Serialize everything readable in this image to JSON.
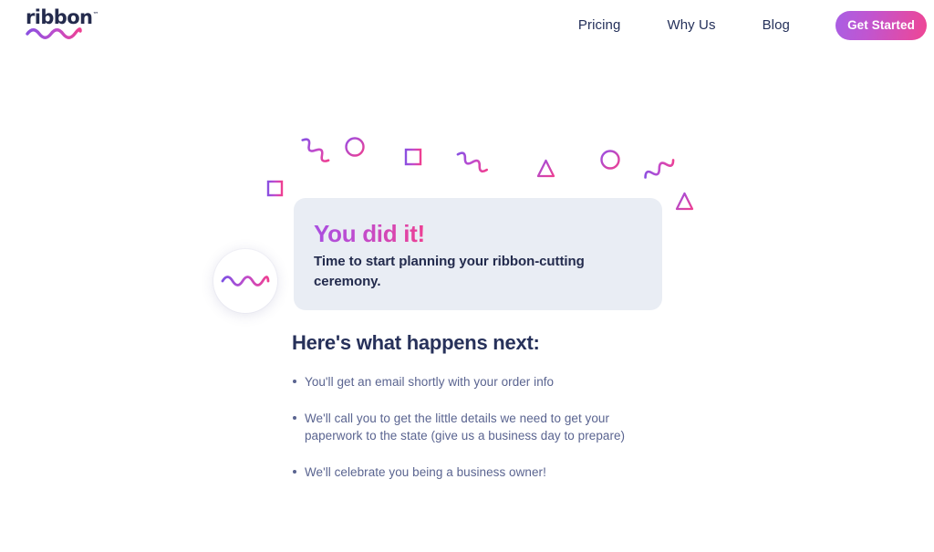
{
  "header": {
    "brand": {
      "name": "ribbon",
      "trademark": "™",
      "wave_icon": "ribbon-wave-icon"
    },
    "nav": [
      {
        "label": "Pricing",
        "name": "nav-link-pricing"
      },
      {
        "label": "Why Us",
        "name": "nav-link-why-us"
      },
      {
        "label": "Blog",
        "name": "nav-link-blog"
      }
    ],
    "cta": {
      "label": "Get Started"
    }
  },
  "hero": {
    "seal": {
      "icon": "wave-squiggle-icon"
    },
    "card": {
      "heading": "You did it!",
      "body": "Time to start planning your ribbon-cutting ceremony."
    },
    "next_steps": {
      "heading": "Here's what happens next:",
      "items": [
        "You'll get an email shortly with your order info",
        "We'll call you to get the little details we need to get your paperwork to the state (give us a business day to prepare)",
        "We'll celebrate you being a business owner!"
      ]
    }
  },
  "confetti": {
    "shapes": [
      "square",
      "circle",
      "square",
      "squiggle",
      "squiggle",
      "triangle",
      "circle",
      "squiggle",
      "triangle"
    ]
  },
  "colors": {
    "gradient_start": "#a94fe0",
    "gradient_mid": "#c14ccd",
    "gradient_end": "#ee3f92",
    "navy": "#27315a",
    "muted_text": "#5a6490",
    "card_bg": "#e9edf4",
    "page_bg": "#ffffff"
  }
}
